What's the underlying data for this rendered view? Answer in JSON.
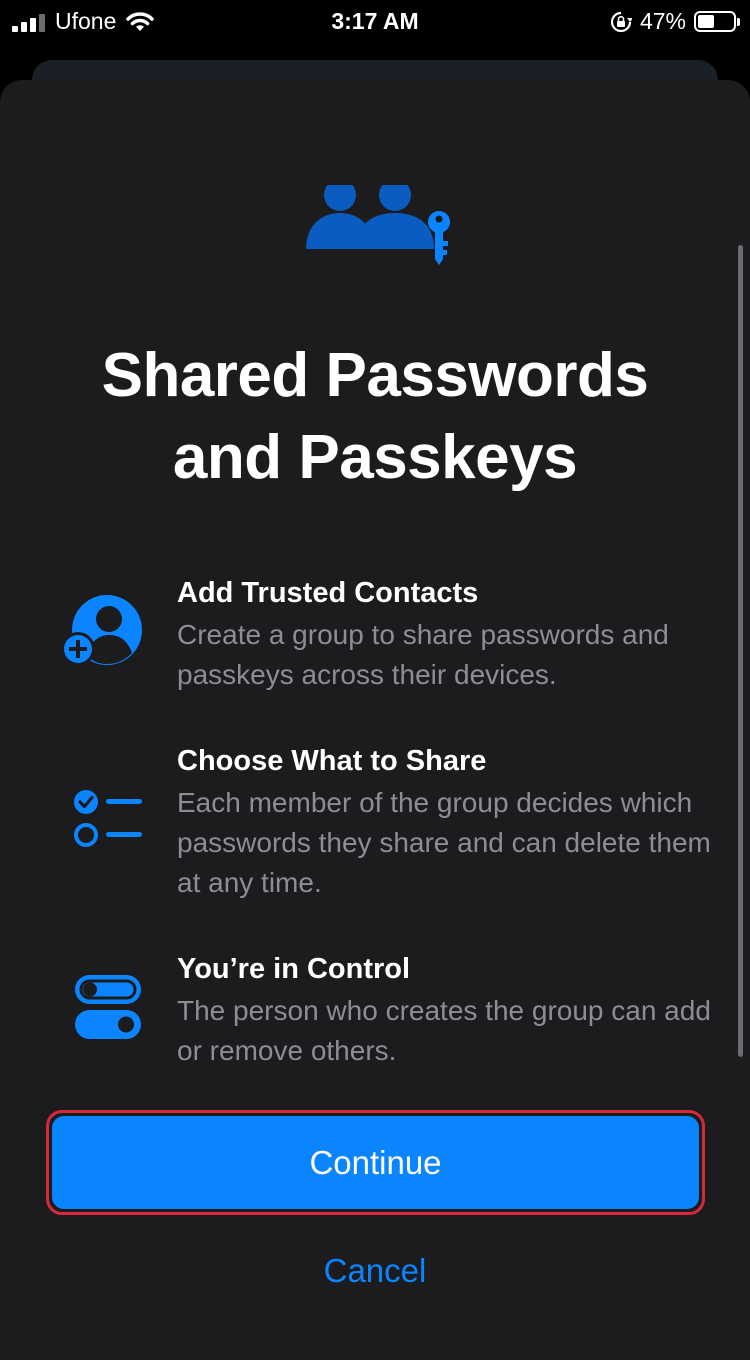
{
  "status_bar": {
    "carrier": "Ufone",
    "time": "3:17 AM",
    "battery_percent": "47%",
    "battery_level": 0.47,
    "icons": [
      "signal-icon",
      "wifi-icon",
      "rotation-lock-icon",
      "battery-icon"
    ]
  },
  "header": {
    "icon": "shared-passwords-icon",
    "title_line1": "Shared Passwords",
    "title_line2": "and Passkeys"
  },
  "features": [
    {
      "icon": "add-contact-icon",
      "title": "Add Trusted Contacts",
      "description": "Create a group to share passwords and passkeys across their devices."
    },
    {
      "icon": "checklist-icon",
      "title": "Choose What to Share",
      "description": "Each member of the group decides which passwords they share and can delete them at any time."
    },
    {
      "icon": "toggles-icon",
      "title": "You’re in Control",
      "description": "The person who creates the group can add or remove others."
    }
  ],
  "actions": {
    "continue_label": "Continue",
    "cancel_label": "Cancel"
  },
  "colors": {
    "accent": "#0a84ff",
    "sheet_background": "#1c1c1e",
    "secondary_text": "#8d8d93",
    "highlight_border": "#d8283c"
  }
}
